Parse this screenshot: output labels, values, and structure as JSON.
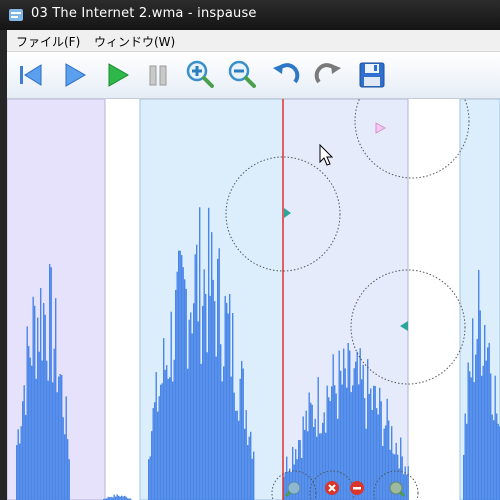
{
  "window": {
    "title": "03 The Internet 2.wma - inspause"
  },
  "menu": {
    "items": [
      {
        "label": "ファイル(F)"
      },
      {
        "label": "ウィンドウ(W)"
      }
    ]
  },
  "toolbar": {
    "buttons": [
      {
        "name": "skip-to-start",
        "icon": "skip-back-icon"
      },
      {
        "name": "play",
        "icon": "play-icon"
      },
      {
        "name": "play-green",
        "icon": "play-green-icon"
      },
      {
        "name": "pause",
        "icon": "pause-icon"
      },
      {
        "name": "zoom-in",
        "icon": "zoom-in-icon"
      },
      {
        "name": "zoom-out",
        "icon": "zoom-out-icon"
      },
      {
        "name": "undo",
        "icon": "undo-icon"
      },
      {
        "name": "redo",
        "icon": "redo-icon"
      },
      {
        "name": "save",
        "icon": "save-icon"
      }
    ]
  },
  "colors": {
    "waveform": "#4a86e8",
    "region_purple": "#e6e2fb",
    "region_blue": "#dcedfb",
    "region_lavender": "#e6ebfb",
    "cursor": "#e03030",
    "handle": "#2aa59a"
  }
}
